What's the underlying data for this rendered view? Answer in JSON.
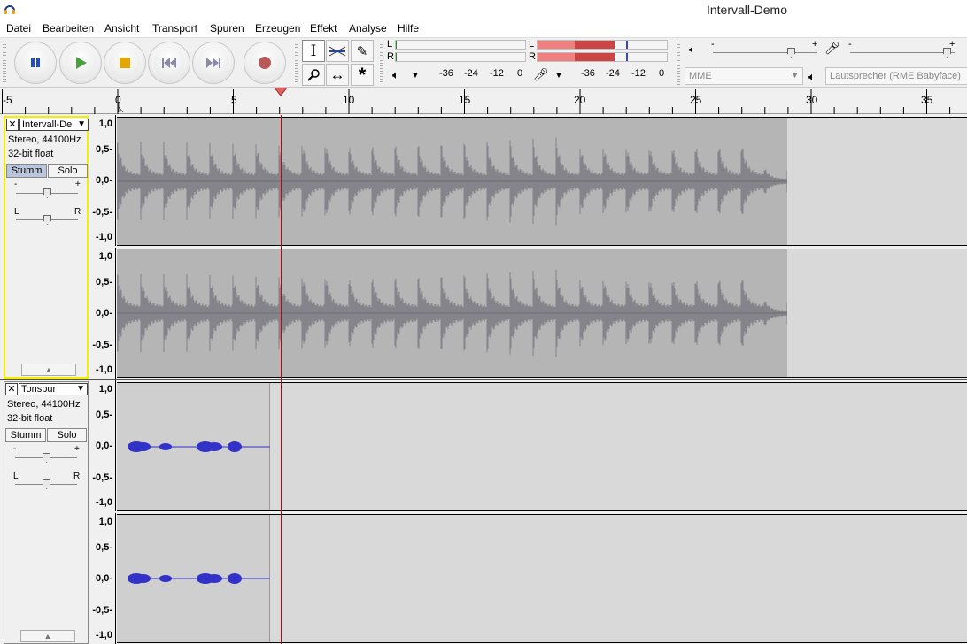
{
  "window": {
    "title": "Intervall-Demo"
  },
  "menu": [
    "Datei",
    "Bearbeiten",
    "Ansicht",
    "Transport",
    "Spuren",
    "Erzeugen",
    "Effekt",
    "Analyse",
    "Hilfe"
  ],
  "transport": {
    "pause": "pause-icon",
    "play": "play-icon",
    "stop": "stop-icon",
    "skip_start": "skip-to-start-icon",
    "skip_end": "skip-to-end-icon",
    "record": "record-icon"
  },
  "meters": {
    "playback": {
      "left_label": "L",
      "right_label": "R",
      "ticks": [
        "-36",
        "-24",
        "-12",
        "0"
      ]
    },
    "record": {
      "left_label": "L",
      "right_label": "R",
      "ticks": [
        "-36",
        "-24",
        "-12",
        "0"
      ]
    }
  },
  "mixer": {
    "minus": "-",
    "plus": "+"
  },
  "devices": {
    "host": "MME",
    "output": "Lautsprecher (RME Babyface)"
  },
  "ruler": {
    "labels": [
      "-5",
      "0",
      "5",
      "10",
      "15",
      "20",
      "25",
      "30",
      "35"
    ]
  },
  "scale_labels": [
    "1,0",
    "0,5-",
    "0,0-",
    "-0,5-",
    "-1,0"
  ],
  "tracks": [
    {
      "name": "Intervall-De",
      "format": "Stereo, 44100Hz",
      "bits": "32-bit float",
      "mute": "Stumm",
      "solo": "Solo",
      "gain_minus": "-",
      "gain_plus": "+",
      "pan_left": "L",
      "pan_right": "R"
    },
    {
      "name": "Tonspur",
      "format": "Stereo, 44100Hz",
      "bits": "32-bit float",
      "mute": "Stumm",
      "solo": "Solo",
      "gain_minus": "-",
      "gain_plus": "+",
      "pan_left": "L",
      "pan_right": "R"
    }
  ],
  "colors": {
    "waveform_gray": "#7f7f84",
    "waveform_blue": "#3232c8",
    "selection_yellow": "#f2f000",
    "playhead": "#cc0000",
    "meter_red": "#e85a5a"
  }
}
